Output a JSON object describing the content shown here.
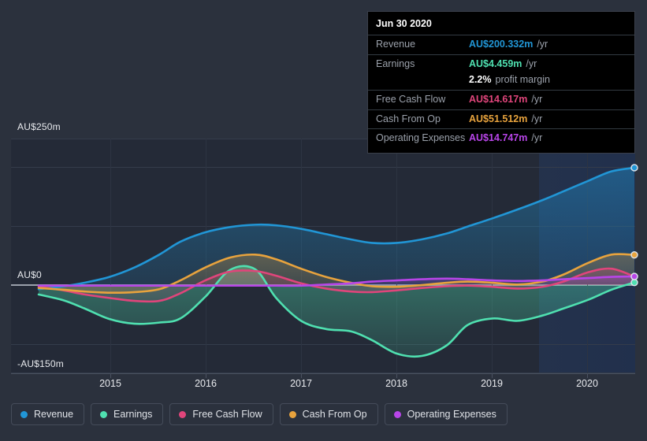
{
  "tooltip": {
    "date": "Jun 30 2020",
    "rows": [
      {
        "label": "Revenue",
        "value": "AU$200.332m",
        "unit": "/yr",
        "color": "#2196d6"
      },
      {
        "label": "Earnings",
        "value": "AU$4.459m",
        "unit": "/yr",
        "color": "#4fe0b0"
      },
      {
        "label": "Free Cash Flow",
        "value": "AU$14.617m",
        "unit": "/yr",
        "color": "#e0457b"
      },
      {
        "label": "Cash From Op",
        "value": "AU$51.512m",
        "unit": "/yr",
        "color": "#e8a33d"
      },
      {
        "label": "Operating Expenses",
        "value": "AU$14.747m",
        "unit": "/yr",
        "color": "#b845e8"
      }
    ],
    "profit_margin_value": "2.2%",
    "profit_margin_label": "profit margin"
  },
  "legend": [
    {
      "label": "Revenue",
      "color": "#2196d6"
    },
    {
      "label": "Earnings",
      "color": "#4fe0b0"
    },
    {
      "label": "Free Cash Flow",
      "color": "#e0457b"
    },
    {
      "label": "Cash From Op",
      "color": "#e8a33d"
    },
    {
      "label": "Operating Expenses",
      "color": "#b845e8"
    }
  ],
  "axis": {
    "y_top_label": "AU$250m",
    "y_zero_label": "AU$0",
    "y_bottom_label": "-AU$150m",
    "x_labels": [
      "2015",
      "2016",
      "2017",
      "2018",
      "2019",
      "2020"
    ]
  },
  "chart_data": {
    "type": "area",
    "title": "",
    "xlabel": "",
    "ylabel": "AU$",
    "ylim": [
      -150,
      250
    ],
    "yticks": [
      -150,
      -100,
      0,
      100,
      200,
      250
    ],
    "ytick_labels": [
      "-AU$150m",
      "",
      "AU$0",
      "",
      "",
      "AU$250m"
    ],
    "grid": true,
    "legend_position": "bottom",
    "xlim": [
      2014.52,
      2020.74
    ],
    "x_tick_values": [
      2015,
      2016,
      2017,
      2018,
      2019,
      2020
    ],
    "forecast_start_x": 2020.0,
    "x": [
      2014.52,
      2014.78,
      2015.0,
      2015.26,
      2015.52,
      2015.78,
      2016.0,
      2016.26,
      2016.52,
      2016.78,
      2017.0,
      2017.26,
      2017.52,
      2017.78,
      2018.0,
      2018.26,
      2018.52,
      2018.78,
      2019.0,
      2019.26,
      2019.52,
      2019.78,
      2020.0,
      2020.26,
      2020.5,
      2020.74
    ],
    "series": [
      {
        "name": "Revenue",
        "color": "#2196d6",
        "unit": "AU$m",
        "values": [
          -7,
          -2,
          4,
          14,
          30,
          52,
          74,
          90,
          99,
          103,
          102,
          96,
          87,
          78,
          72,
          72,
          78,
          88,
          100,
          114,
          129,
          145,
          160,
          178,
          194,
          200.332
        ]
      },
      {
        "name": "Earnings",
        "color": "#4fe0b0",
        "unit": "AU$m",
        "values": [
          -16,
          -26,
          -40,
          -58,
          -66,
          -64,
          -57,
          -20,
          26,
          27,
          -22,
          -61,
          -75,
          -79,
          -94,
          -117,
          -121,
          -103,
          -68,
          -57,
          -61,
          -52,
          -40,
          -25,
          -8,
          4.459
        ]
      },
      {
        "name": "Free Cash Flow",
        "color": "#e0457b",
        "unit": "AU$m",
        "values": [
          -3,
          -9,
          -16,
          -22,
          -27,
          -27,
          -14,
          8,
          23,
          24,
          16,
          3,
          -6,
          -11,
          -12,
          -9,
          -5,
          -2,
          -1,
          -3,
          -6,
          -3,
          6,
          22,
          28,
          14.617
        ]
      },
      {
        "name": "Cash From Op",
        "color": "#e8a33d",
        "unit": "AU$m",
        "values": [
          -5,
          -8,
          -11,
          -13,
          -12,
          -7,
          8,
          30,
          47,
          52,
          44,
          28,
          14,
          4,
          -2,
          -3,
          0,
          4,
          6,
          4,
          1,
          6,
          18,
          38,
          52,
          51.512
        ]
      },
      {
        "name": "Operating Expenses",
        "color": "#b845e8",
        "unit": "AU$m",
        "values": [
          -1,
          -1,
          -1,
          -1,
          -1,
          -1,
          -1,
          -1,
          -1,
          -1,
          -1,
          -1,
          1,
          3,
          6,
          8,
          10,
          11,
          10,
          8,
          7,
          8,
          10,
          12,
          14,
          14.747
        ]
      }
    ]
  }
}
